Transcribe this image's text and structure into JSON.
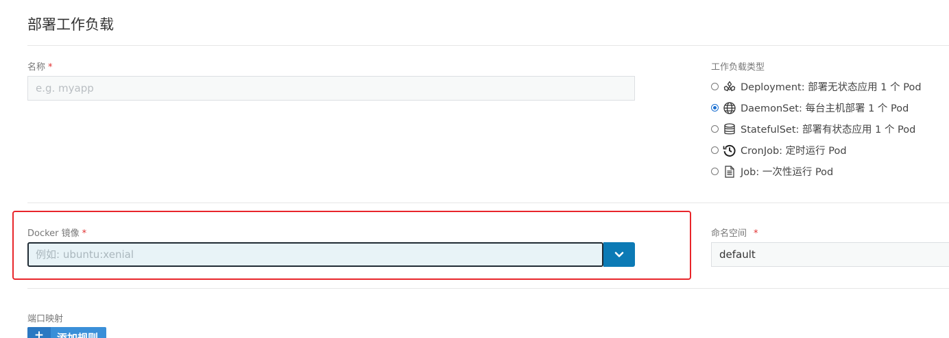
{
  "page": {
    "title": "部署工作负载"
  },
  "name_field": {
    "label": "名称",
    "required_mark": "*",
    "value": "",
    "placeholder": "e.g. myapp"
  },
  "workload_type": {
    "label": "工作负载类型",
    "options": [
      {
        "label": "Deployment: 部署无状态应用 1 个 Pod",
        "icon": "deployment-icon",
        "checked": false
      },
      {
        "label": "DaemonSet: 每台主机部署 1 个 Pod",
        "icon": "globe-icon",
        "checked": true
      },
      {
        "label": "StatefulSet: 部署有状态应用 1 个 Pod",
        "icon": "database-icon",
        "checked": false
      },
      {
        "label": "CronJob: 定时运行 Pod",
        "icon": "history-clock-icon",
        "checked": false
      },
      {
        "label": "Job: 一次性运行 Pod",
        "icon": "document-icon",
        "checked": false
      }
    ]
  },
  "docker_image": {
    "label": "Docker 镜像",
    "required_mark": "*",
    "value": "",
    "placeholder": "例如: ubuntu:xenial",
    "dropdown_icon": "chevron-down-icon"
  },
  "namespace": {
    "label": "命名空间",
    "required_mark": "*",
    "value": "default"
  },
  "port_mapping": {
    "label": "端口映射",
    "add_button_icon": "+",
    "add_button_label": "添加规则"
  },
  "colors": {
    "primary": "#0c7ab5",
    "highlight": "#e8252a",
    "required": "#e03030"
  }
}
